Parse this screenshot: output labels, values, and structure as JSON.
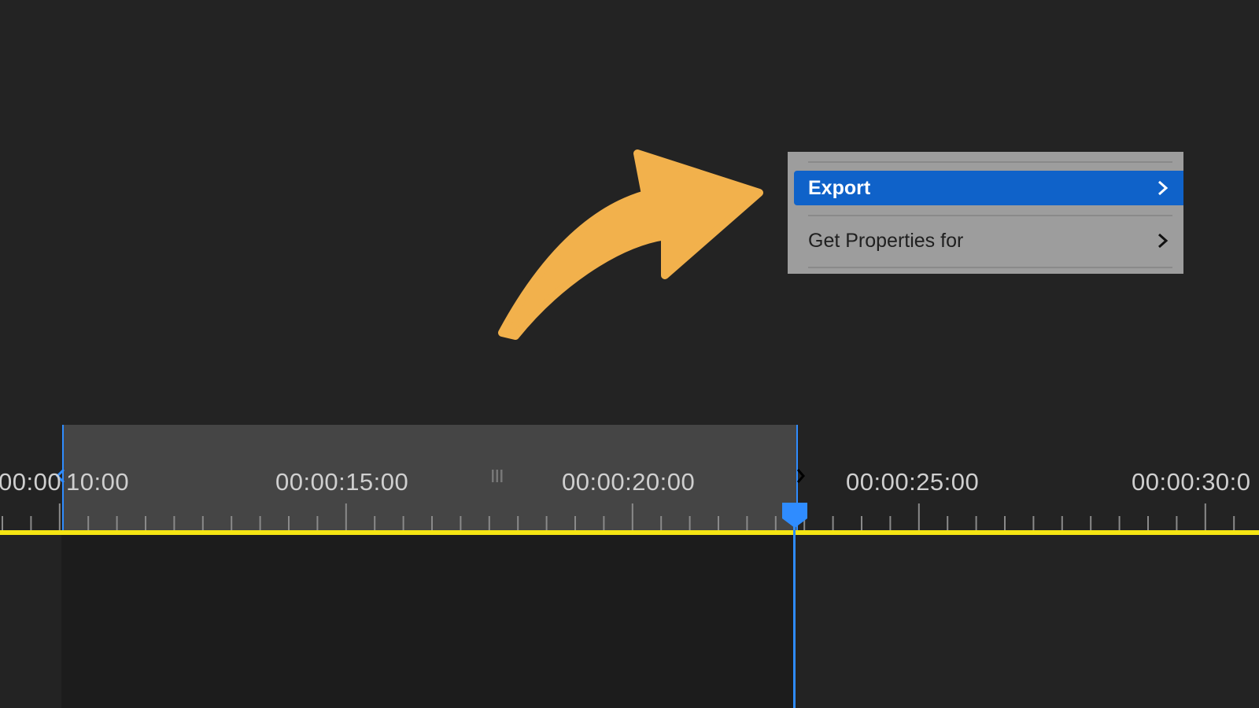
{
  "menu": {
    "items": [
      {
        "label": "Export",
        "highlighted": true
      },
      {
        "label": "Get Properties for",
        "highlighted": false
      }
    ],
    "highlight_color": "#0f62c9"
  },
  "timeline": {
    "ruler_labels": [
      "00:00",
      "10:00",
      "00:00:15:00",
      "00:00:20:00",
      "00:00:25:00",
      "00:00:30:0"
    ],
    "timeline_bar_color": "#f5e513",
    "playhead_color": "#2f8cff"
  },
  "callout": {
    "icon": "curved-arrow-icon",
    "color": "#f2b14c"
  }
}
